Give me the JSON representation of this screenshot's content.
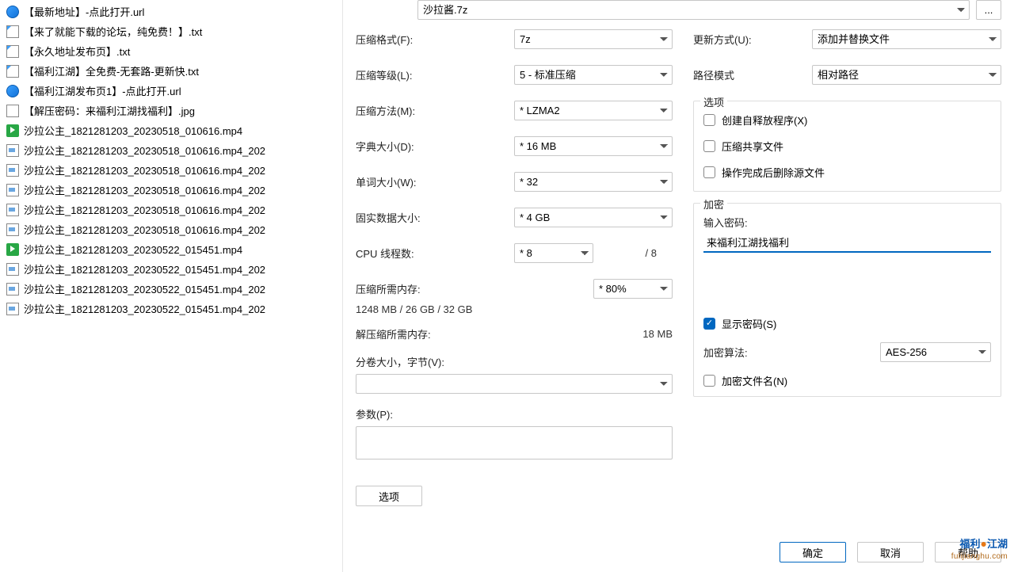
{
  "files": [
    {
      "icon": "url",
      "name": "【最新地址】-点此打开.url"
    },
    {
      "icon": "txt",
      "name": "【来了就能下载的论坛，纯免费！】.txt"
    },
    {
      "icon": "txt",
      "name": "【永久地址发布页】.txt"
    },
    {
      "icon": "txt",
      "name": "【福利江湖】全免费-无套路-更新快.txt"
    },
    {
      "icon": "url",
      "name": "【福利江湖发布页1】-点此打开.url"
    },
    {
      "icon": "jpg",
      "name": "【解压密码：来福利江湖找福利】.jpg"
    },
    {
      "icon": "mp4",
      "name": "沙拉公主_1821281203_20230518_010616.mp4"
    },
    {
      "icon": "part",
      "name": "沙拉公主_1821281203_20230518_010616.mp4_202"
    },
    {
      "icon": "part",
      "name": "沙拉公主_1821281203_20230518_010616.mp4_202"
    },
    {
      "icon": "part",
      "name": "沙拉公主_1821281203_20230518_010616.mp4_202"
    },
    {
      "icon": "part",
      "name": "沙拉公主_1821281203_20230518_010616.mp4_202"
    },
    {
      "icon": "part",
      "name": "沙拉公主_1821281203_20230518_010616.mp4_202"
    },
    {
      "icon": "mp4",
      "name": "沙拉公主_1821281203_20230522_015451.mp4"
    },
    {
      "icon": "part",
      "name": "沙拉公主_1821281203_20230522_015451.mp4_202"
    },
    {
      "icon": "part",
      "name": "沙拉公主_1821281203_20230522_015451.mp4_202"
    },
    {
      "icon": "part",
      "name": "沙拉公主_1821281203_20230522_015451.mp4_202"
    }
  ],
  "archive_name": "沙拉酱.7z",
  "ellipsis": "...",
  "left": {
    "format_label": "压缩格式(F):",
    "format_value": "7z",
    "level_label": "压缩等级(L):",
    "level_value": "5 - 标准压缩",
    "method_label": "压缩方法(M):",
    "method_value": "* LZMA2",
    "dict_label": "字典大小(D):",
    "dict_value": "* 16 MB",
    "word_label": "单词大小(W):",
    "word_value": "* 32",
    "solid_label": "固实数据大小:",
    "solid_value": "* 4 GB",
    "cpu_label": "CPU 线程数:",
    "cpu_value": "* 8",
    "cpu_total": "/ 8",
    "compmem_label": "压缩所需内存:",
    "compmem_value": "1248 MB / 26 GB / 32 GB",
    "compmem_pct": "* 80%",
    "decompmem_label": "解压缩所需内存:",
    "decompmem_value": "18 MB",
    "split_label": "分卷大小，字节(V):",
    "param_label": "参数(P):",
    "option_btn": "选项"
  },
  "right": {
    "update_label": "更新方式(U):",
    "update_value": "添加并替换文件",
    "path_label": "路径模式",
    "path_value": "相对路径",
    "options_title": "选项",
    "opt_sfx": "创建自释放程序(X)",
    "opt_share": "压缩共享文件",
    "opt_delete": "操作完成后删除源文件",
    "encrypt_title": "加密",
    "pwd_label": "输入密码:",
    "pwd_value": "来福利江湖找福利",
    "showpwd": "显示密码(S)",
    "alg_label": "加密算法:",
    "alg_value": "AES-256",
    "encnames": "加密文件名(N)"
  },
  "buttons": {
    "ok": "确定",
    "cancel": "取消",
    "help": "帮助"
  },
  "watermark": {
    "a": "福利",
    "b": "江湖",
    "sub": "fulijianghu.com"
  }
}
